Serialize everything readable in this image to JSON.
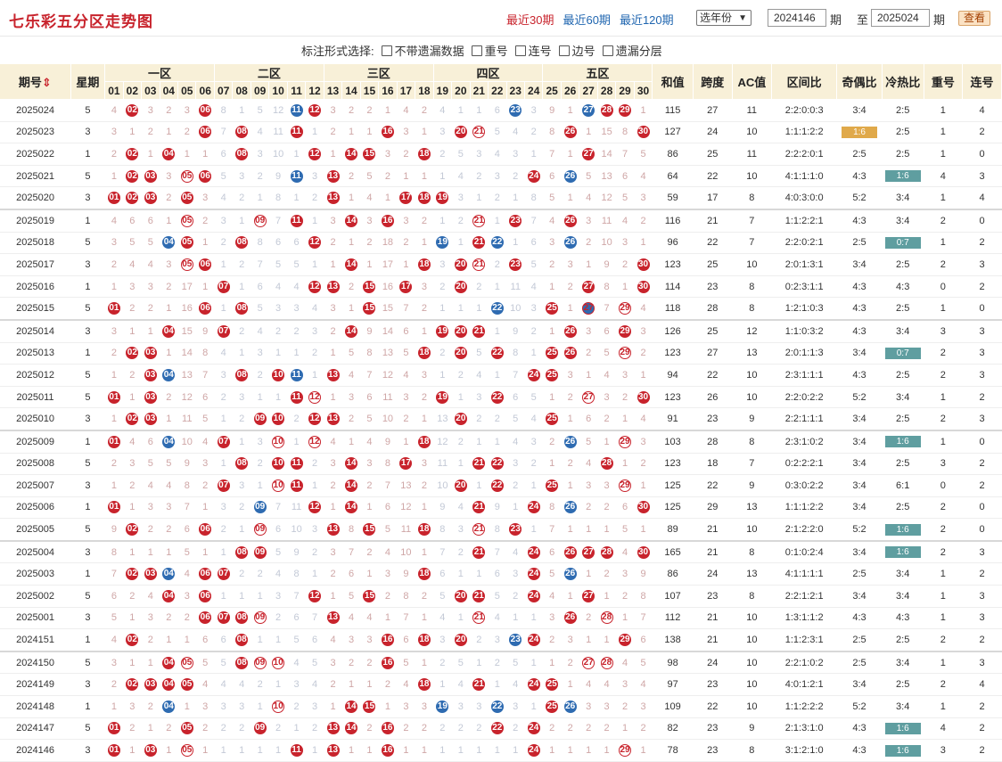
{
  "header": {
    "title": "七乐彩五分区走势图",
    "nav": [
      "最近30期",
      "最近60期",
      "最近120期"
    ],
    "year_select": "选年份",
    "from_issue": "2024146",
    "issue_label": "期",
    "to_label": "至",
    "to_issue": "2025024",
    "query_button": "查看"
  },
  "options": {
    "label": "标注形式选择:",
    "items": [
      "不带遗漏数据",
      "重号",
      "连号",
      "边号",
      "遗漏分层"
    ]
  },
  "table": {
    "col_period": "期号",
    "col_weekday": "星期",
    "zones": [
      "一区",
      "二区",
      "三区",
      "四区",
      "五区"
    ],
    "numbers": [
      "01",
      "02",
      "03",
      "04",
      "05",
      "06",
      "07",
      "08",
      "09",
      "10",
      "11",
      "12",
      "13",
      "14",
      "15",
      "16",
      "17",
      "18",
      "19",
      "20",
      "21",
      "22",
      "23",
      "24",
      "25",
      "26",
      "27",
      "28",
      "29",
      "30"
    ],
    "stat_cols": [
      "和值",
      "跨度",
      "AC值",
      "区间比",
      "奇偶比",
      "冷热比",
      "重号",
      "连号"
    ],
    "rows": [
      {
        "period": "2025024",
        "week": "5",
        "sum": "115",
        "span": "27",
        "ac": "11",
        "zone": "2:2:0:0:3",
        "oe": "3:4",
        "hc": "2:5",
        "repeat": "1",
        "consec": "4",
        "hits": [
          2,
          6,
          11,
          12,
          23,
          27,
          28,
          29
        ]
      },
      {
        "period": "2025023",
        "week": "3",
        "sum": "127",
        "span": "24",
        "ac": "10",
        "zone": "1:1:1:2:2",
        "oe": "1:6",
        "hc": "2:5",
        "repeat": "1",
        "consec": "2",
        "hits": [
          6,
          8,
          11,
          16,
          20,
          21,
          26,
          30
        ]
      },
      {
        "period": "2025022",
        "week": "1",
        "sum": "86",
        "span": "25",
        "ac": "11",
        "zone": "2:2:2:0:1",
        "oe": "2:5",
        "hc": "2:5",
        "repeat": "1",
        "consec": "0",
        "hits": [
          2,
          4,
          8,
          12,
          14,
          15,
          18,
          27
        ]
      },
      {
        "period": "2025021",
        "week": "5",
        "sum": "64",
        "span": "22",
        "ac": "10",
        "zone": "4:1:1:1:0",
        "oe": "4:3",
        "hc": "1:6",
        "repeat": "4",
        "consec": "3",
        "hits": [
          2,
          3,
          5,
          6,
          11,
          13,
          24,
          26
        ]
      },
      {
        "period": "2025020",
        "week": "3",
        "sum": "59",
        "span": "17",
        "ac": "8",
        "zone": "4:0:3:0:0",
        "oe": "5:2",
        "hc": "3:4",
        "repeat": "1",
        "consec": "4",
        "hits": [
          1,
          2,
          3,
          5,
          13,
          17,
          18,
          19
        ]
      },
      {
        "period": "2025019",
        "week": "1",
        "sum": "116",
        "span": "21",
        "ac": "7",
        "zone": "1:1:2:2:1",
        "oe": "4:3",
        "hc": "3:4",
        "repeat": "2",
        "consec": "0",
        "hits": [
          5,
          9,
          11,
          14,
          16,
          21,
          23,
          26
        ]
      },
      {
        "period": "2025018",
        "week": "5",
        "sum": "96",
        "span": "22",
        "ac": "7",
        "zone": "2:2:0:2:1",
        "oe": "2:5",
        "hc": "0:7",
        "repeat": "1",
        "consec": "2",
        "hits": [
          4,
          5,
          8,
          12,
          19,
          21,
          22,
          26
        ]
      },
      {
        "period": "2025017",
        "week": "3",
        "sum": "123",
        "span": "25",
        "ac": "10",
        "zone": "2:0:1:3:1",
        "oe": "3:4",
        "hc": "2:5",
        "repeat": "2",
        "consec": "3",
        "hits": [
          5,
          6,
          14,
          18,
          20,
          21,
          23,
          30
        ]
      },
      {
        "period": "2025016",
        "week": "1",
        "sum": "114",
        "span": "23",
        "ac": "8",
        "zone": "0:2:3:1:1",
        "oe": "4:3",
        "hc": "4:3",
        "repeat": "0",
        "consec": "2",
        "hits": [
          7,
          12,
          13,
          15,
          17,
          20,
          27,
          30
        ]
      },
      {
        "period": "2025015",
        "week": "5",
        "sum": "118",
        "span": "28",
        "ac": "8",
        "zone": "1:2:1:0:3",
        "oe": "4:3",
        "hc": "2:5",
        "repeat": "1",
        "consec": "0",
        "hits": [
          1,
          6,
          8,
          15,
          22,
          25,
          27,
          29
        ]
      },
      {
        "period": "2025014",
        "week": "3",
        "sum": "126",
        "span": "25",
        "ac": "12",
        "zone": "1:1:0:3:2",
        "oe": "4:3",
        "hc": "3:4",
        "repeat": "3",
        "consec": "3",
        "hits": [
          4,
          7,
          14,
          19,
          20,
          21,
          26,
          29
        ]
      },
      {
        "period": "2025013",
        "week": "1",
        "sum": "123",
        "span": "27",
        "ac": "13",
        "zone": "2:0:1:1:3",
        "oe": "3:4",
        "hc": "0:7",
        "repeat": "2",
        "consec": "3",
        "hits": [
          2,
          3,
          18,
          20,
          22,
          25,
          26,
          29
        ]
      },
      {
        "period": "2025012",
        "week": "5",
        "sum": "94",
        "span": "22",
        "ac": "10",
        "zone": "2:3:1:1:1",
        "oe": "4:3",
        "hc": "2:5",
        "repeat": "2",
        "consec": "3",
        "hits": [
          3,
          4,
          8,
          10,
          11,
          13,
          24,
          25
        ]
      },
      {
        "period": "2025011",
        "week": "5",
        "sum": "123",
        "span": "26",
        "ac": "10",
        "zone": "2:2:0:2:2",
        "oe": "5:2",
        "hc": "3:4",
        "repeat": "1",
        "consec": "2",
        "hits": [
          1,
          3,
          11,
          12,
          19,
          22,
          27,
          30
        ]
      },
      {
        "period": "2025010",
        "week": "3",
        "sum": "91",
        "span": "23",
        "ac": "9",
        "zone": "2:2:1:1:1",
        "oe": "3:4",
        "hc": "2:5",
        "repeat": "2",
        "consec": "3",
        "hits": [
          2,
          3,
          9,
          10,
          12,
          13,
          20,
          25
        ]
      },
      {
        "period": "2025009",
        "week": "1",
        "sum": "103",
        "span": "28",
        "ac": "8",
        "zone": "2:3:1:0:2",
        "oe": "3:4",
        "hc": "1:6",
        "repeat": "1",
        "consec": "0",
        "hits": [
          1,
          4,
          7,
          10,
          12,
          18,
          26,
          29
        ]
      },
      {
        "period": "2025008",
        "week": "5",
        "sum": "123",
        "span": "18",
        "ac": "7",
        "zone": "0:2:2:2:1",
        "oe": "3:4",
        "hc": "2:5",
        "repeat": "3",
        "consec": "2",
        "hits": [
          8,
          10,
          11,
          14,
          17,
          21,
          22,
          28
        ]
      },
      {
        "period": "2025007",
        "week": "3",
        "sum": "125",
        "span": "22",
        "ac": "9",
        "zone": "0:3:0:2:2",
        "oe": "3:4",
        "hc": "6:1",
        "repeat": "0",
        "consec": "2",
        "hits": [
          7,
          10,
          11,
          14,
          20,
          22,
          25,
          29
        ]
      },
      {
        "period": "2025006",
        "week": "1",
        "sum": "125",
        "span": "29",
        "ac": "13",
        "zone": "1:1:1:2:2",
        "oe": "3:4",
        "hc": "2:5",
        "repeat": "2",
        "consec": "0",
        "hits": [
          1,
          9,
          12,
          14,
          21,
          24,
          26,
          30
        ]
      },
      {
        "period": "2025005",
        "week": "5",
        "sum": "89",
        "span": "21",
        "ac": "10",
        "zone": "2:1:2:2:0",
        "oe": "5:2",
        "hc": "1:6",
        "repeat": "2",
        "consec": "0",
        "hits": [
          2,
          6,
          9,
          13,
          15,
          18,
          21,
          23
        ]
      },
      {
        "period": "2025004",
        "week": "3",
        "sum": "165",
        "span": "21",
        "ac": "8",
        "zone": "0:1:0:2:4",
        "oe": "3:4",
        "hc": "1:6",
        "repeat": "2",
        "consec": "3",
        "hits": [
          8,
          9,
          21,
          24,
          26,
          27,
          28,
          30
        ]
      },
      {
        "period": "2025003",
        "week": "1",
        "sum": "86",
        "span": "24",
        "ac": "13",
        "zone": "4:1:1:1:1",
        "oe": "2:5",
        "hc": "3:4",
        "repeat": "1",
        "consec": "2",
        "hits": [
          2,
          3,
          4,
          6,
          7,
          18,
          24,
          26
        ]
      },
      {
        "period": "2025002",
        "week": "5",
        "sum": "107",
        "span": "23",
        "ac": "8",
        "zone": "2:2:1:2:1",
        "oe": "3:4",
        "hc": "3:4",
        "repeat": "1",
        "consec": "3",
        "hits": [
          4,
          6,
          12,
          15,
          20,
          21,
          24,
          27
        ]
      },
      {
        "period": "2025001",
        "week": "3",
        "sum": "112",
        "span": "21",
        "ac": "10",
        "zone": "1:3:1:1:2",
        "oe": "4:3",
        "hc": "4:3",
        "repeat": "1",
        "consec": "3",
        "hits": [
          6,
          7,
          8,
          9,
          13,
          21,
          26,
          28
        ]
      },
      {
        "period": "2024151",
        "week": "1",
        "sum": "138",
        "span": "21",
        "ac": "10",
        "zone": "1:1:2:3:1",
        "oe": "2:5",
        "hc": "2:5",
        "repeat": "2",
        "consec": "2",
        "hits": [
          2,
          8,
          16,
          18,
          20,
          23,
          24,
          29
        ]
      },
      {
        "period": "2024150",
        "week": "5",
        "sum": "98",
        "span": "24",
        "ac": "10",
        "zone": "2:2:1:0:2",
        "oe": "2:5",
        "hc": "3:4",
        "repeat": "1",
        "consec": "3",
        "hits": [
          4,
          5,
          8,
          9,
          10,
          16,
          27,
          28
        ]
      },
      {
        "period": "2024149",
        "week": "3",
        "sum": "97",
        "span": "23",
        "ac": "10",
        "zone": "4:0:1:2:1",
        "oe": "3:4",
        "hc": "2:5",
        "repeat": "2",
        "consec": "4",
        "hits": [
          2,
          3,
          4,
          5,
          18,
          21,
          24,
          25
        ]
      },
      {
        "period": "2024148",
        "week": "1",
        "sum": "109",
        "span": "22",
        "ac": "10",
        "zone": "1:1:2:2:2",
        "oe": "5:2",
        "hc": "3:4",
        "repeat": "1",
        "consec": "2",
        "hits": [
          4,
          10,
          14,
          15,
          19,
          22,
          25,
          26
        ]
      },
      {
        "period": "2024147",
        "week": "5",
        "sum": "82",
        "span": "23",
        "ac": "9",
        "zone": "2:1:3:1:0",
        "oe": "4:3",
        "hc": "1:6",
        "repeat": "4",
        "consec": "2",
        "hits": [
          1,
          5,
          9,
          13,
          14,
          16,
          22,
          24
        ]
      },
      {
        "period": "2024146",
        "week": "3",
        "sum": "78",
        "span": "23",
        "ac": "8",
        "zone": "3:1:2:1:0",
        "oe": "4:3",
        "hc": "1:6",
        "repeat": "3",
        "consec": "2",
        "hits": [
          1,
          3,
          5,
          11,
          13,
          16,
          24,
          29
        ]
      }
    ]
  }
}
